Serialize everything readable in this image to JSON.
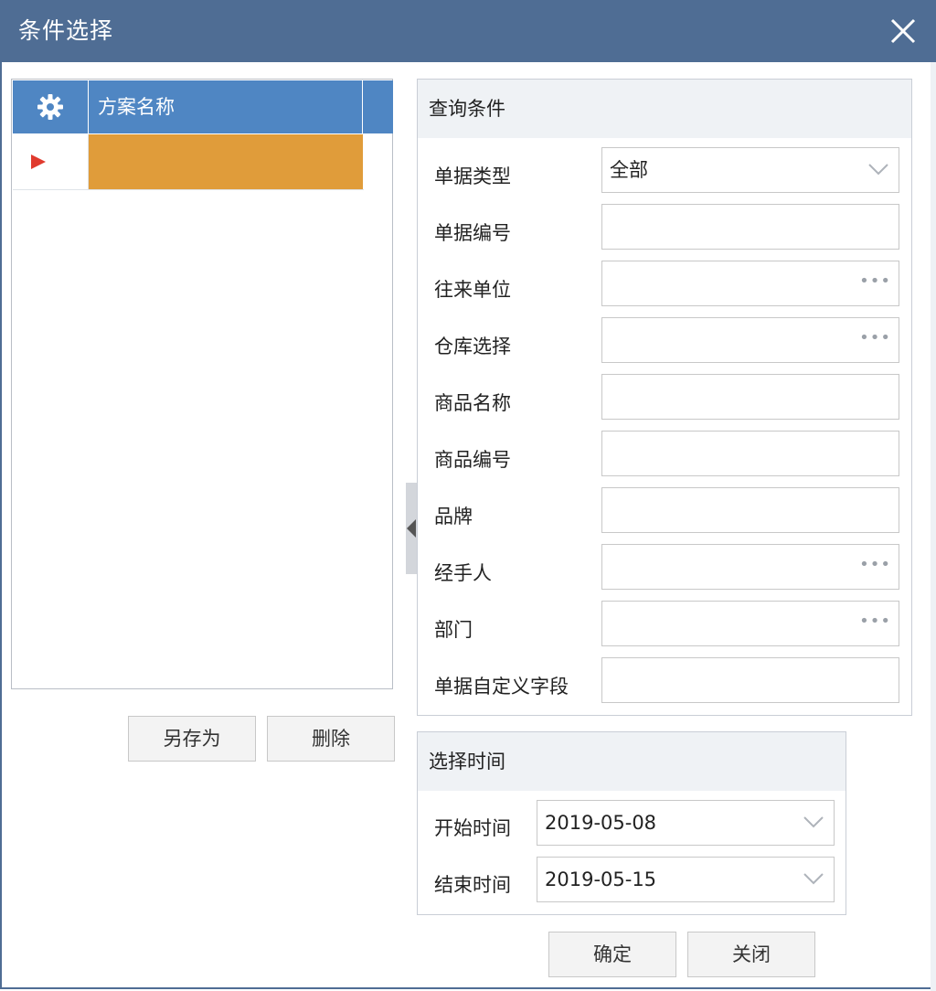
{
  "window": {
    "title": "条件选择"
  },
  "scheme": {
    "name_header": "方案名称",
    "rows": [
      {
        "name": ""
      }
    ],
    "save_as_label": "另存为",
    "delete_label": "删除"
  },
  "query": {
    "title": "查询条件",
    "fields": {
      "doc_type": {
        "label": "单据类型",
        "value": "全部"
      },
      "doc_number": {
        "label": "单据编号",
        "value": ""
      },
      "partner": {
        "label": "往来单位",
        "value": ""
      },
      "warehouse": {
        "label": "仓库选择",
        "value": ""
      },
      "product_name": {
        "label": "商品名称",
        "value": ""
      },
      "product_code": {
        "label": "商品编号",
        "value": ""
      },
      "brand": {
        "label": "品牌",
        "value": ""
      },
      "handler": {
        "label": "经手人",
        "value": ""
      },
      "department": {
        "label": "部门",
        "value": ""
      },
      "custom_field": {
        "label": "单据自定义字段",
        "value": ""
      }
    }
  },
  "time": {
    "title": "选择时间",
    "start": {
      "label": "开始时间",
      "value": "2019-05-08"
    },
    "end": {
      "label": "结束时间",
      "value": "2019-05-15"
    }
  },
  "footer": {
    "ok_label": "确定",
    "close_label": "关闭"
  },
  "colors": {
    "titlebar": "#4f6d94",
    "grid_header": "#4f86c3",
    "selected_row": "#e09c3a",
    "row_indicator": "#e03a2e"
  },
  "icons": {
    "close": "close-icon",
    "settings": "gear-icon",
    "current_row": "triangle-right-icon",
    "dropdown": "chevron-down-icon",
    "browse": "ellipsis-icon",
    "collapse": "triangle-left-icon"
  }
}
